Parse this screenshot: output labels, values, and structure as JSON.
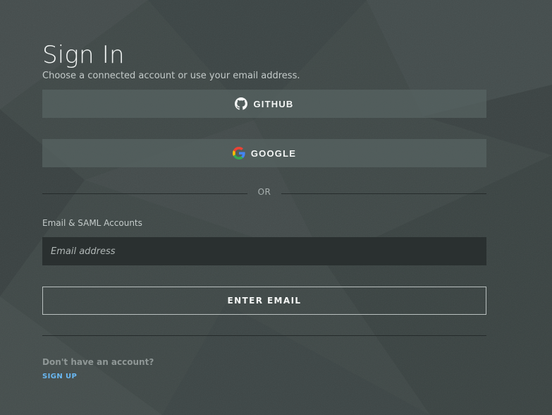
{
  "page": {
    "title": "Sign In",
    "subtitle": "Choose a connected account or use your email address."
  },
  "oauth": {
    "github": {
      "label": "GITHUB",
      "icon": "github-icon"
    },
    "google": {
      "label": "GOOGLE",
      "icon": "google-icon"
    }
  },
  "divider": {
    "text": "OR"
  },
  "email": {
    "section_label": "Email & SAML Accounts",
    "placeholder": "Email address",
    "value": ""
  },
  "actions": {
    "enter_email_label": "ENTER EMAIL"
  },
  "footer": {
    "question": "Don't have an account?",
    "signup_label": "SIGN UP"
  },
  "colors": {
    "background": "#3f4847",
    "button": "#586463",
    "input": "#2a3030",
    "link": "#69b8f3",
    "google_blue": "#4285F4",
    "google_red": "#EA4335",
    "google_yellow": "#FBBC05",
    "google_green": "#34A853"
  }
}
